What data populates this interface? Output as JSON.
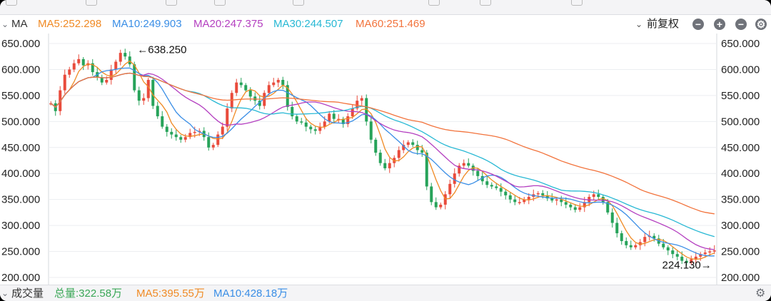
{
  "header": {
    "indicator": "MA",
    "ma_items": [
      {
        "label": "MA5:252.298",
        "color": "#f08a24"
      },
      {
        "label": "MA10:249.903",
        "color": "#3a8ee6"
      },
      {
        "label": "MA20:247.375",
        "color": "#b43fc0"
      },
      {
        "label": "MA30:244.507",
        "color": "#27b8d4"
      },
      {
        "label": "MA60:251.469",
        "color": "#f2733c"
      }
    ],
    "adjust_label": "前复权"
  },
  "volume": {
    "label": "成交量",
    "items": [
      {
        "label": "总量:322.58万",
        "color": "#3aa757"
      },
      {
        "label": "MA5:395.55万",
        "color": "#f08a24"
      },
      {
        "label": "MA10:428.18万",
        "color": "#3a8ee6"
      }
    ]
  },
  "chart_data": {
    "type": "line",
    "y_ticks": [
      "650.000",
      "600.000",
      "550.000",
      "500.000",
      "450.000",
      "400.000",
      "350.000",
      "300.000",
      "250.000",
      "200.000"
    ],
    "ylim": [
      200,
      650
    ],
    "grid": true,
    "annotations": [
      {
        "text": "←638.250",
        "value": 638.25,
        "index": 37
      },
      {
        "text": "224.130→",
        "value": 224.13,
        "index": 300
      }
    ],
    "price": [
      535,
      520,
      560,
      590,
      600,
      612,
      620,
      608,
      612,
      595,
      585,
      575,
      580,
      600,
      615,
      632,
      625,
      610,
      560,
      540,
      545,
      580,
      530,
      510,
      490,
      480,
      475,
      470,
      465,
      470,
      478,
      480,
      482,
      470,
      450,
      455,
      475,
      490,
      525,
      555,
      575,
      570,
      560,
      548,
      540,
      530,
      555,
      570,
      575,
      580,
      570,
      528,
      510,
      500,
      498,
      490,
      485,
      482,
      490,
      500,
      515,
      505,
      505,
      495,
      510,
      525,
      540,
      545,
      500,
      465,
      440,
      420,
      410,
      420,
      430,
      445,
      455,
      460,
      455,
      445,
      440,
      375,
      345,
      335,
      340,
      360,
      380,
      400,
      415,
      420,
      415,
      405,
      395,
      385,
      378,
      375,
      372,
      365,
      358,
      350,
      345,
      345,
      350,
      355,
      360,
      362,
      358,
      352,
      348,
      350,
      345,
      340,
      335,
      330,
      335,
      345,
      355,
      360,
      355,
      345,
      325,
      305,
      285,
      270,
      262,
      258,
      262,
      268,
      278,
      280,
      275,
      265,
      258,
      252,
      245,
      240,
      232,
      228,
      235,
      240,
      245,
      248,
      250,
      252
    ],
    "series": [
      {
        "name": "MA5",
        "color": "#f08a24",
        "window": 5
      },
      {
        "name": "MA10",
        "color": "#3a8ee6",
        "window": 10
      },
      {
        "name": "MA20",
        "color": "#b43fc0",
        "window": 20
      },
      {
        "name": "MA30",
        "color": "#27b8d4",
        "window": 30
      },
      {
        "name": "MA60",
        "color": "#f2733c",
        "window": 60
      }
    ]
  }
}
